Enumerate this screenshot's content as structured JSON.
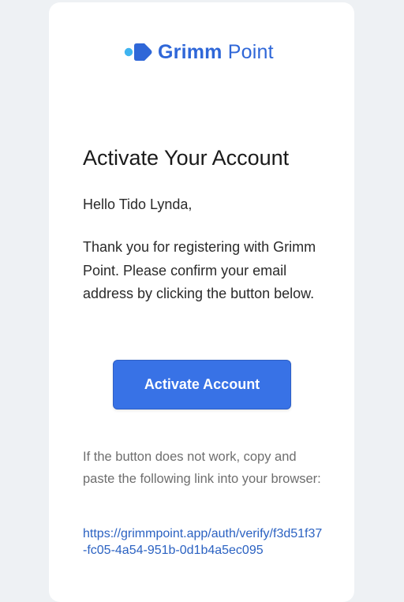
{
  "brand": {
    "name_bold": "Grimm",
    "name_light": "Point",
    "color": "#2f67d8",
    "accent_dot_color": "#3fb4f0",
    "icon": "grimm-point-logo-icon"
  },
  "email": {
    "title": "Activate Your Account",
    "greeting": "Hello Tido Lynda,",
    "body": "Thank you for registering with Grimm Point. Please confirm your email address by clicking the button below.",
    "button_label": "Activate Account",
    "button_color": "#3872e6",
    "fallback_text": "If the button does not work, copy and paste the following link into your browser:",
    "link": "https://grimmpoint.app/auth/verify/f3d51f37-fc05-4a54-951b-0d1b4a5ec095"
  }
}
